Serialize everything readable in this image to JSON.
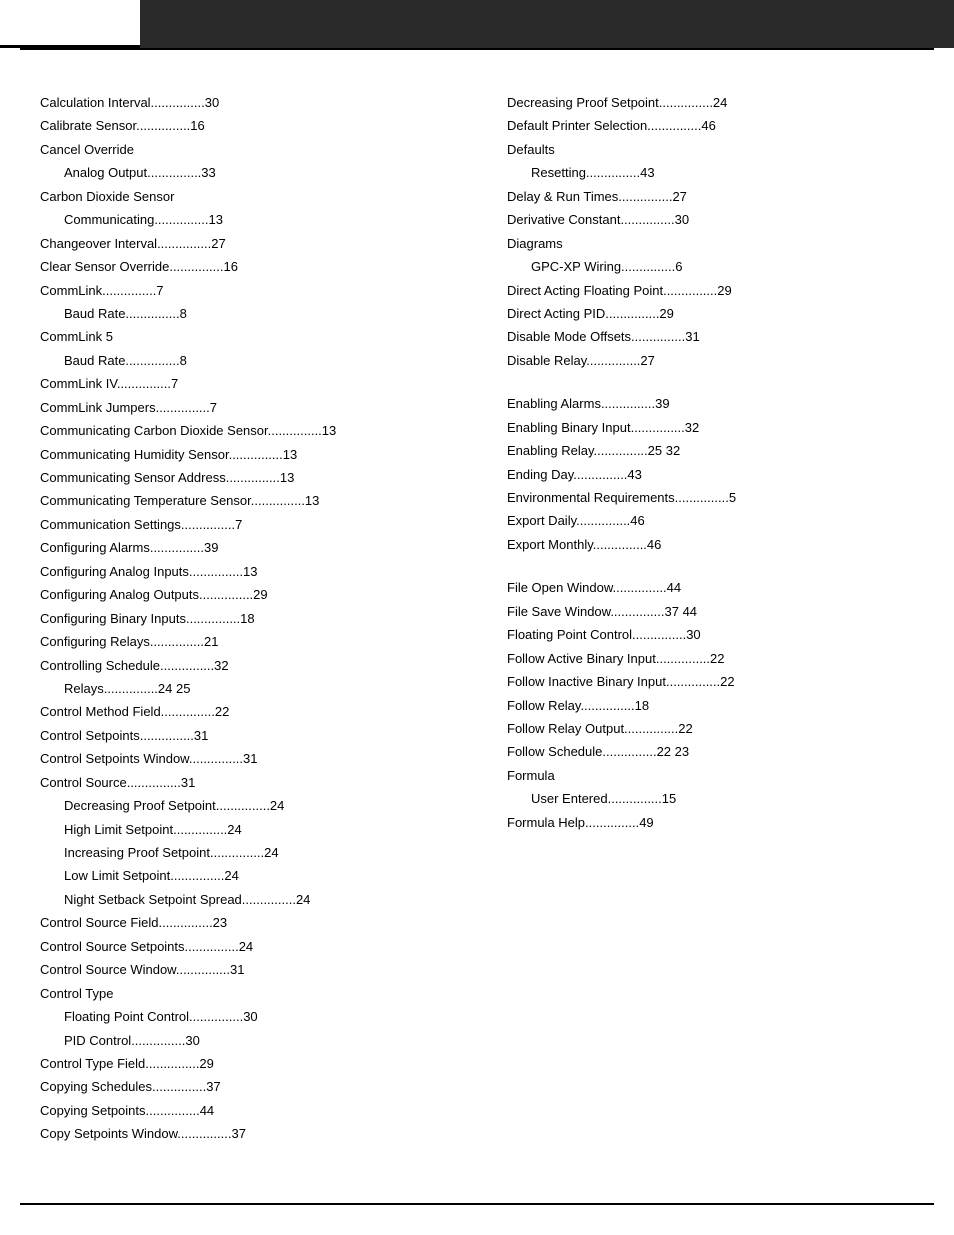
{
  "header": {
    "tab_label": ""
  },
  "left_column": {
    "entries": [
      {
        "text": "Calculation Interval...............30",
        "type": "main"
      },
      {
        "text": "Calibrate Sensor...............16",
        "type": "main"
      },
      {
        "text": "Cancel Override",
        "type": "main"
      },
      {
        "text": "Analog Output...............33",
        "type": "sub"
      },
      {
        "text": "Carbon Dioxide Sensor",
        "type": "main"
      },
      {
        "text": "Communicating...............13",
        "type": "sub"
      },
      {
        "text": "Changeover Interval...............27",
        "type": "main"
      },
      {
        "text": "Clear Sensor Override...............16",
        "type": "main"
      },
      {
        "text": "CommLink...............7",
        "type": "main"
      },
      {
        "text": "Baud Rate...............8",
        "type": "sub"
      },
      {
        "text": "CommLink 5",
        "type": "main"
      },
      {
        "text": "Baud Rate...............8",
        "type": "sub"
      },
      {
        "text": "CommLink IV...............7",
        "type": "main"
      },
      {
        "text": "CommLink Jumpers...............7",
        "type": "main"
      },
      {
        "text": "Communicating Carbon Dioxide Sensor...............13",
        "type": "main"
      },
      {
        "text": "Communicating Humidity Sensor...............13",
        "type": "main"
      },
      {
        "text": "Communicating Sensor Address...............13",
        "type": "main"
      },
      {
        "text": "Communicating Temperature Sensor...............13",
        "type": "main"
      },
      {
        "text": "Communication Settings...............7",
        "type": "main"
      },
      {
        "text": "Configuring Alarms...............39",
        "type": "main"
      },
      {
        "text": "Configuring Analog Inputs...............13",
        "type": "main"
      },
      {
        "text": "Configuring Analog Outputs...............29",
        "type": "main"
      },
      {
        "text": "Configuring Binary Inputs...............18",
        "type": "main"
      },
      {
        "text": "Configuring Relays...............21",
        "type": "main"
      },
      {
        "text": "Controlling Schedule...............32",
        "type": "main"
      },
      {
        "text": "Relays...............24 25",
        "type": "sub"
      },
      {
        "text": "Control Method Field...............22",
        "type": "main"
      },
      {
        "text": "Control Setpoints...............31",
        "type": "main"
      },
      {
        "text": "Control Setpoints Window...............31",
        "type": "main"
      },
      {
        "text": "Control Source...............31",
        "type": "main"
      },
      {
        "text": "Decreasing Proof Setpoint...............24",
        "type": "sub"
      },
      {
        "text": "High Limit Setpoint...............24",
        "type": "sub"
      },
      {
        "text": "Increasing Proof Setpoint...............24",
        "type": "sub"
      },
      {
        "text": "Low Limit Setpoint...............24",
        "type": "sub"
      },
      {
        "text": "Night Setback Setpoint Spread...............24",
        "type": "sub"
      },
      {
        "text": "Control Source Field...............23",
        "type": "main"
      },
      {
        "text": "Control Source Setpoints...............24",
        "type": "main"
      },
      {
        "text": "Control Source Window...............31",
        "type": "main"
      },
      {
        "text": "Control Type",
        "type": "main"
      },
      {
        "text": "Floating Point Control...............30",
        "type": "sub"
      },
      {
        "text": "PID Control...............30",
        "type": "sub"
      },
      {
        "text": "Control Type Field...............29",
        "type": "main"
      },
      {
        "text": "Copying Schedules...............37",
        "type": "main"
      },
      {
        "text": "Copying Setpoints...............44",
        "type": "main"
      },
      {
        "text": "Copy Setpoints Window...............37",
        "type": "main"
      }
    ]
  },
  "right_column": {
    "sections": [
      {
        "entries": [
          {
            "text": "Decreasing Proof Setpoint...............24",
            "type": "main"
          },
          {
            "text": "Default Printer Selection...............46",
            "type": "main"
          },
          {
            "text": "Defaults",
            "type": "main"
          },
          {
            "text": "Resetting...............43",
            "type": "sub"
          },
          {
            "text": "Delay & Run Times...............27",
            "type": "main"
          },
          {
            "text": "Derivative Constant...............30",
            "type": "main"
          },
          {
            "text": "Diagrams",
            "type": "main"
          },
          {
            "text": "GPC-XP Wiring...............6",
            "type": "sub"
          },
          {
            "text": "Direct Acting Floating Point...............29",
            "type": "main"
          },
          {
            "text": "Direct Acting PID...............29",
            "type": "main"
          },
          {
            "text": "Disable Mode Offsets...............31",
            "type": "main"
          },
          {
            "text": "Disable Relay...............27",
            "type": "main"
          }
        ]
      },
      {
        "entries": [
          {
            "text": "Enabling Alarms...............39",
            "type": "main"
          },
          {
            "text": "Enabling Binary Input...............32",
            "type": "main"
          },
          {
            "text": "Enabling Relay...............25 32",
            "type": "main"
          },
          {
            "text": "Ending Day...............43",
            "type": "main"
          },
          {
            "text": "Environmental Requirements...............5",
            "type": "main"
          },
          {
            "text": "Export Daily...............46",
            "type": "main"
          },
          {
            "text": "Export Monthly...............46",
            "type": "main"
          }
        ]
      },
      {
        "entries": [
          {
            "text": "File Open Window...............44",
            "type": "main"
          },
          {
            "text": "File Save Window...............37 44",
            "type": "main"
          },
          {
            "text": "Floating Point Control...............30",
            "type": "main"
          },
          {
            "text": "Follow Active Binary Input...............22",
            "type": "main"
          },
          {
            "text": "Follow Inactive Binary Input...............22",
            "type": "main"
          },
          {
            "text": "Follow Relay...............18",
            "type": "main"
          },
          {
            "text": "Follow Relay Output...............22",
            "type": "main"
          },
          {
            "text": "Follow Schedule...............22 23",
            "type": "main"
          },
          {
            "text": "Formula",
            "type": "main"
          },
          {
            "text": "User Entered...............15",
            "type": "sub"
          },
          {
            "text": "Formula Help...............49",
            "type": "main"
          }
        ]
      }
    ]
  }
}
